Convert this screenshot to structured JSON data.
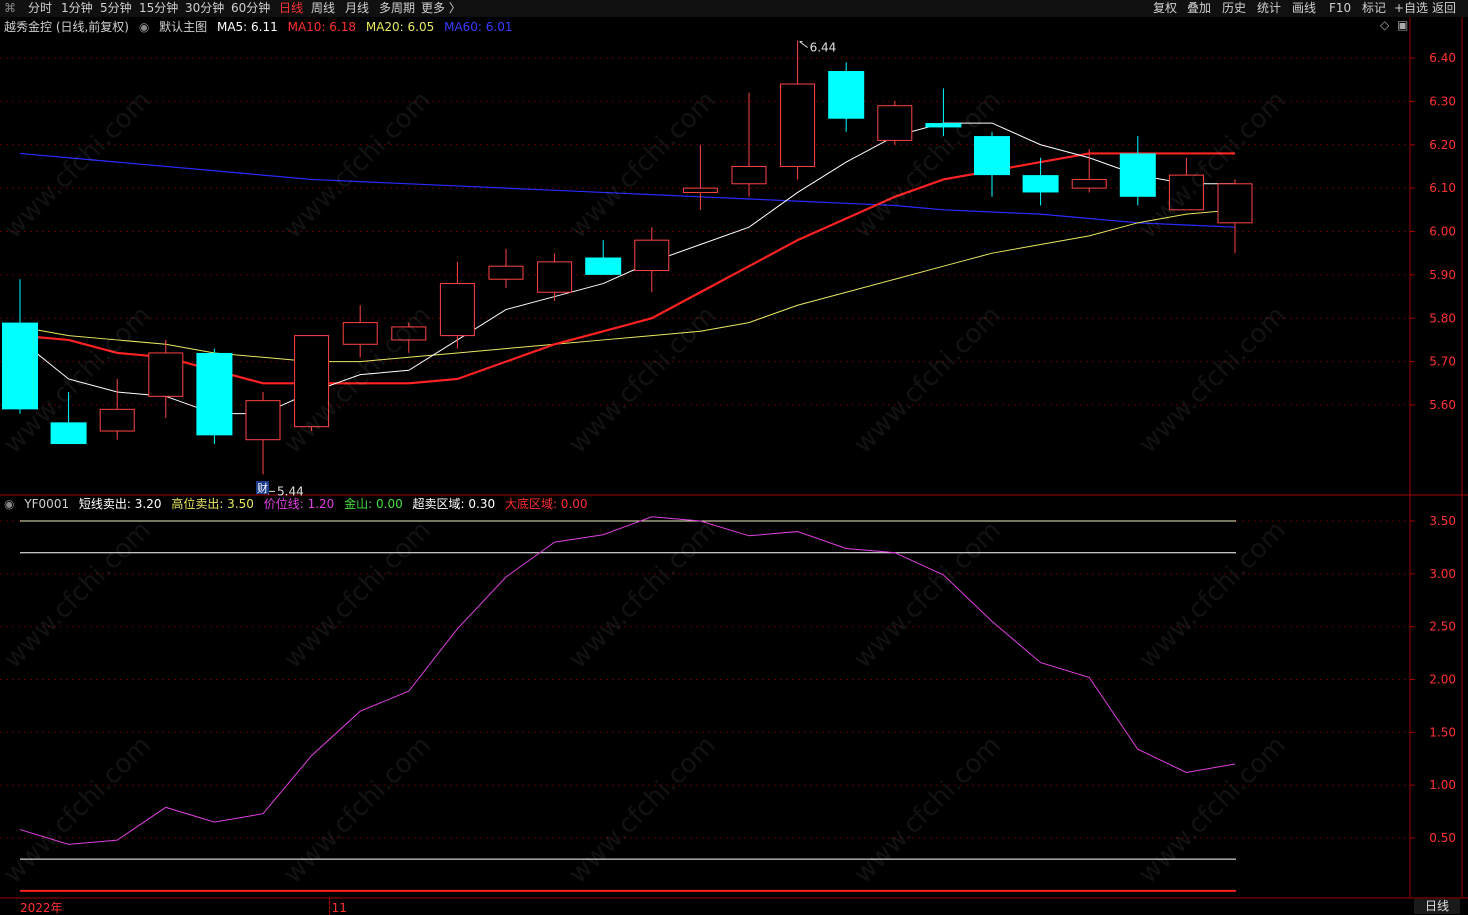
{
  "toolbar": {
    "left": [
      "分时",
      "1分钟",
      "5分钟",
      "15分钟",
      "30分钟",
      "60分钟",
      "日线",
      "周线",
      "月线",
      "多周期",
      "更多 〉"
    ],
    "right": [
      "复权",
      "叠加",
      "历史",
      "统计",
      "画线",
      "F10",
      "标记",
      "+自选",
      "返回"
    ],
    "active": "日线"
  },
  "main_legend": {
    "stock": "越秀金控 (日线,前复权)",
    "template": "默认主图",
    "ma5": "MA5: 6.11",
    "ma10": "MA10: 6.18",
    "ma20": "MA20: 6.05",
    "ma60": "MA60: 6.01"
  },
  "sub_legend": {
    "name": "YF0001",
    "short_sell": "短线卖出: 3.20",
    "high_sell": "高位卖出: 3.50",
    "price_line": "价位线: 1.20",
    "golden": "金山: 0.00",
    "oversold": "超卖区域: 0.30",
    "bottom": "大底区域: 0.00"
  },
  "annotations": {
    "high": "6.44",
    "low": "5.44",
    "cai": "财"
  },
  "time_axis": [
    "2022年",
    "11"
  ],
  "bottom_tab": "日线",
  "watermark": "www.cfchi.com",
  "colors": {
    "up": "#ff4444",
    "down": "#00ffff",
    "ma5": "#ffffff",
    "ma10": "#ff2222",
    "ma20": "#e8e860",
    "ma60": "#2a2aff",
    "price_line": "#e040e0",
    "grid": "#5a0000",
    "axis": "#a00000"
  },
  "chart_data": [
    {
      "type": "candlestick",
      "ylim": [
        5.44,
        6.44
      ],
      "y_ticks": [
        "6.40",
        "6.30",
        "6.20",
        "6.10",
        "6.00",
        "5.90",
        "5.80",
        "5.70",
        "5.60"
      ],
      "candles": [
        {
          "o": 5.79,
          "h": 5.89,
          "l": 5.58,
          "c": 5.59
        },
        {
          "o": 5.56,
          "h": 5.63,
          "l": 5.51,
          "c": 5.51
        },
        {
          "o": 5.54,
          "h": 5.66,
          "l": 5.52,
          "c": 5.59
        },
        {
          "o": 5.62,
          "h": 5.75,
          "l": 5.57,
          "c": 5.72
        },
        {
          "o": 5.72,
          "h": 5.73,
          "l": 5.51,
          "c": 5.53
        },
        {
          "o": 5.52,
          "h": 5.63,
          "l": 5.44,
          "c": 5.61
        },
        {
          "o": 5.55,
          "h": 5.76,
          "l": 5.54,
          "c": 5.76
        },
        {
          "o": 5.74,
          "h": 5.83,
          "l": 5.71,
          "c": 5.79
        },
        {
          "o": 5.75,
          "h": 5.79,
          "l": 5.72,
          "c": 5.78
        },
        {
          "o": 5.76,
          "h": 5.93,
          "l": 5.73,
          "c": 5.88
        },
        {
          "o": 5.89,
          "h": 5.96,
          "l": 5.87,
          "c": 5.92
        },
        {
          "o": 5.86,
          "h": 5.95,
          "l": 5.84,
          "c": 5.93
        },
        {
          "o": 5.94,
          "h": 5.98,
          "l": 5.9,
          "c": 5.9
        },
        {
          "o": 5.91,
          "h": 6.01,
          "l": 5.86,
          "c": 5.98
        },
        {
          "o": 6.09,
          "h": 6.2,
          "l": 6.05,
          "c": 6.1
        },
        {
          "o": 6.11,
          "h": 6.32,
          "l": 6.08,
          "c": 6.15
        },
        {
          "o": 6.15,
          "h": 6.44,
          "l": 6.12,
          "c": 6.34
        },
        {
          "o": 6.37,
          "h": 6.39,
          "l": 6.23,
          "c": 6.26
        },
        {
          "o": 6.21,
          "h": 6.3,
          "l": 6.2,
          "c": 6.29
        },
        {
          "o": 6.25,
          "h": 6.33,
          "l": 6.22,
          "c": 6.24
        },
        {
          "o": 6.22,
          "h": 6.23,
          "l": 6.08,
          "c": 6.13
        },
        {
          "o": 6.13,
          "h": 6.17,
          "l": 6.06,
          "c": 6.09
        },
        {
          "o": 6.1,
          "h": 6.19,
          "l": 6.09,
          "c": 6.12
        },
        {
          "o": 6.18,
          "h": 6.22,
          "l": 6.06,
          "c": 6.08
        },
        {
          "o": 6.05,
          "h": 6.17,
          "l": 6.05,
          "c": 6.13
        },
        {
          "o": 6.02,
          "h": 6.12,
          "l": 5.95,
          "c": 6.11
        }
      ],
      "ma5": [
        5.75,
        5.66,
        5.63,
        5.62,
        5.58,
        5.58,
        5.63,
        5.67,
        5.68,
        5.75,
        5.82,
        5.85,
        5.88,
        5.93,
        5.97,
        6.01,
        6.09,
        6.16,
        6.22,
        6.25,
        6.25,
        6.2,
        6.17,
        6.13,
        6.11,
        6.11
      ],
      "ma10": [
        5.76,
        5.75,
        5.72,
        5.71,
        5.68,
        5.65,
        5.65,
        5.65,
        5.65,
        5.66,
        5.7,
        5.74,
        5.77,
        5.8,
        5.86,
        5.92,
        5.98,
        6.03,
        6.08,
        6.12,
        6.14,
        6.16,
        6.18,
        6.18,
        6.18,
        6.18
      ],
      "ma20": [
        5.78,
        5.76,
        5.75,
        5.74,
        5.72,
        5.71,
        5.7,
        5.7,
        5.71,
        5.72,
        5.73,
        5.74,
        5.75,
        5.76,
        5.77,
        5.79,
        5.83,
        5.86,
        5.89,
        5.92,
        5.95,
        5.97,
        5.99,
        6.02,
        6.04,
        6.05
      ],
      "ma60": [
        6.18,
        6.17,
        6.16,
        6.15,
        6.14,
        6.13,
        6.12,
        6.115,
        6.11,
        6.105,
        6.1,
        6.095,
        6.09,
        6.085,
        6.08,
        6.075,
        6.07,
        6.065,
        6.06,
        6.05,
        6.045,
        6.04,
        6.03,
        6.02,
        6.015,
        6.01
      ]
    },
    {
      "type": "line",
      "ylim": [
        0.0,
        3.7
      ],
      "y_ticks": [
        "3.50",
        "3.00",
        "2.50",
        "2.00",
        "1.50",
        "1.00",
        "0.50"
      ],
      "series": [
        {
          "name": "价位线",
          "values": [
            0.58,
            0.44,
            0.48,
            0.79,
            0.65,
            0.73,
            1.28,
            1.7,
            1.89,
            2.48,
            2.97,
            3.3,
            3.37,
            3.54,
            3.5,
            3.36,
            3.4,
            3.24,
            3.2,
            2.99,
            2.55,
            2.16,
            2.02,
            1.34,
            1.12,
            1.2
          ]
        },
        {
          "name": "短线卖出",
          "values": [
            3.2
          ]
        },
        {
          "name": "高位卖出",
          "values": [
            3.5
          ]
        },
        {
          "name": "超卖区域",
          "values": [
            0.3
          ]
        },
        {
          "name": "大底区域",
          "values": [
            0.0
          ]
        }
      ]
    }
  ]
}
